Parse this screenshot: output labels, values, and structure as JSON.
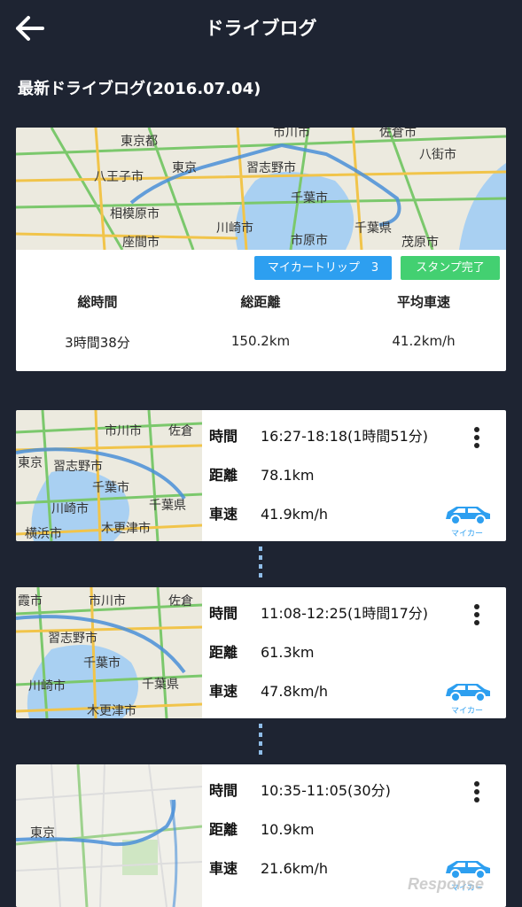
{
  "header": {
    "title": "ドライブログ",
    "back_icon": "arrow-left-icon"
  },
  "section_title": "最新ドライブログ(2016.07.04)",
  "summary": {
    "trip_badge": "マイカートリップ　3",
    "stamp_badge": "スタンプ完了",
    "stats": [
      {
        "label": "総時間",
        "value": "3時間38分"
      },
      {
        "label": "総距離",
        "value": "150.2km"
      },
      {
        "label": "平均車速",
        "value": "41.2km/h"
      }
    ],
    "map_labels": [
      "東京都",
      "市川市",
      "佐倉市",
      "八街市",
      "八王子市",
      "東京",
      "習志野市",
      "相模原市",
      "千葉市",
      "座間市",
      "川崎市",
      "市原市",
      "千葉県",
      "茂原市"
    ]
  },
  "trips": [
    {
      "time_label": "時間",
      "time_value": "16:27-18:18(1時間51分)",
      "distance_label": "距離",
      "distance_value": "78.1km",
      "speed_label": "車速",
      "speed_value": "41.9km/h",
      "vehicle": "マイカー",
      "map_labels": [
        "市川市",
        "佐倉",
        "東京",
        "習志野市",
        "千葉市",
        "川崎市",
        "千葉県",
        "横浜市",
        "木更津市"
      ]
    },
    {
      "time_label": "時間",
      "time_value": "11:08-12:25(1時間17分)",
      "distance_label": "距離",
      "distance_value": "61.3km",
      "speed_label": "車速",
      "speed_value": "47.8km/h",
      "vehicle": "マイカー",
      "map_labels": [
        "霞市",
        "市川市",
        "佐倉",
        "習志野市",
        "千葉市",
        "川崎市",
        "千葉県",
        "木更津市"
      ]
    },
    {
      "time_label": "時間",
      "time_value": "10:35-11:05(30分)",
      "distance_label": "距離",
      "distance_value": "10.9km",
      "speed_label": "車速",
      "speed_value": "21.6km/h",
      "vehicle": "マイカー",
      "map_labels": [
        "東京"
      ]
    }
  ],
  "watermark": "Response",
  "colors": {
    "background": "#1e2432",
    "accent_blue": "#2d9ff0",
    "accent_green": "#43d071",
    "route": "#4a8fd8"
  }
}
